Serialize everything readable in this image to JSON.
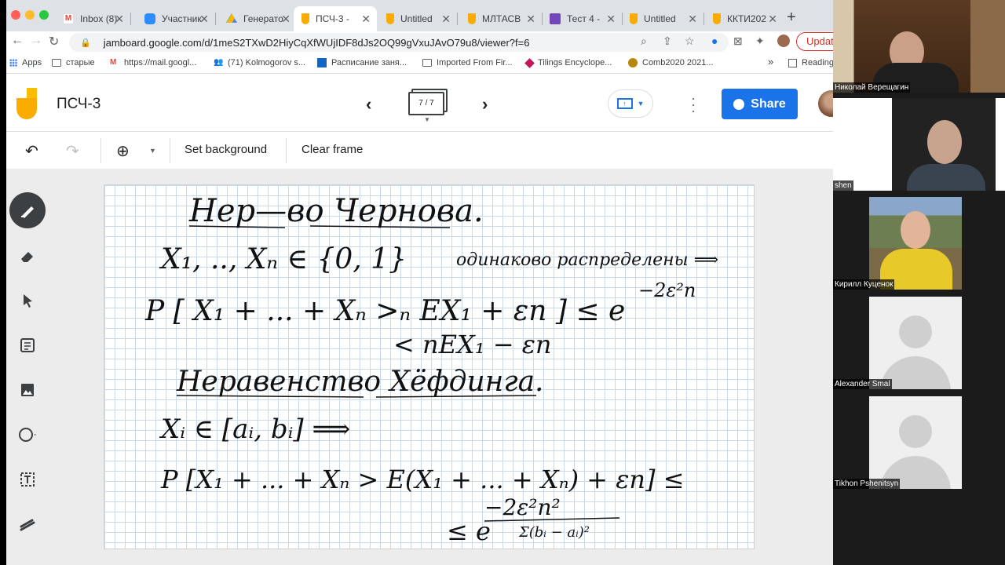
{
  "browser": {
    "tabs": [
      {
        "title": "Inbox (8)",
        "favicon": "gmail-icon",
        "active": false
      },
      {
        "title": "Участник",
        "favicon": "zoom-icon",
        "active": false
      },
      {
        "title": "Генерато",
        "favicon": "drive-icon",
        "active": false
      },
      {
        "title": "ПСЧ-3 -",
        "favicon": "jamboard-icon",
        "active": true
      },
      {
        "title": "Untitled",
        "favicon": "jamboard-icon",
        "active": false
      },
      {
        "title": "МЛТАСВ",
        "favicon": "jamboard-icon",
        "active": false
      },
      {
        "title": "Тест 4 -",
        "favicon": "forms-icon",
        "active": false
      },
      {
        "title": "Untitled",
        "favicon": "jamboard-icon",
        "active": false
      },
      {
        "title": "ККТИ202",
        "favicon": "jamboard-icon",
        "active": false
      }
    ],
    "url": "jamboard.google.com/d/1meS2TXwD2HiyCqXfWUjIDF8dJs2OQ99gVxuJAvO79u8/viewer?f=6",
    "update_label": "Update",
    "bookmarks": [
      {
        "label": "Apps",
        "icon": "apps-icon"
      },
      {
        "label": "старые",
        "icon": "folder-icon"
      },
      {
        "label": "https://mail.googl...",
        "icon": "gmail-icon"
      },
      {
        "label": "(71) Kolmogorov s...",
        "icon": "people-icon"
      },
      {
        "label": "Расписание заня...",
        "icon": "calendar-icon"
      },
      {
        "label": "Imported From Fir...",
        "icon": "folder-icon"
      },
      {
        "label": "Tilings Encyclope...",
        "icon": "tiling-icon"
      },
      {
        "label": "Comb2020 2021...",
        "icon": "globe-icon"
      }
    ],
    "more_bookmarks": "»",
    "reading_list": "Reading"
  },
  "jamboard": {
    "title": "ПСЧ-3",
    "frame_counter": "7 / 7",
    "share_label": "Share",
    "toolbar": {
      "set_background": "Set background",
      "clear_frame": "Clear frame"
    },
    "tools": [
      "pen-icon",
      "eraser-icon",
      "select-icon",
      "sticky-note-icon",
      "image-icon",
      "circle-icon",
      "text-box-icon",
      "laser-icon"
    ],
    "board_lines": {
      "title1": "Нер—во Чернова.",
      "line1": "X₁, .., Xₙ ∈ {0, 1}",
      "line1_note": "одинаково распределены ⟹",
      "line2": "P [ X₁ + ... + Xₙ >ₙ EX₁ + εn ] ≤ e",
      "line2_exp": "−2ε²n",
      "line3": "< nEX₁ − εn",
      "title2": "Неравенство Хёфдинга.",
      "line4": "Xᵢ ∈ [aᵢ, bᵢ] ⟹",
      "line5": "P [X₁ + ... + Xₙ > E(X₁ + ... + Xₙ) + εn] ≤",
      "line6": "≤ e",
      "line6_num": "−2ε²n²",
      "line6_den": "Σ(bᵢ − aᵢ)²"
    }
  },
  "participants": [
    {
      "name": "Николай Верещагин"
    },
    {
      "name": "shen"
    },
    {
      "name": "Кирилл Куценок"
    },
    {
      "name": "Alexander Smal"
    },
    {
      "name": "Tikhon Pshenitsyn"
    }
  ],
  "colors": {
    "accent": "#1a73e8",
    "jam_yellow": "#f9ab00",
    "grid": "#c8dbee",
    "update_red": "#d93025"
  }
}
